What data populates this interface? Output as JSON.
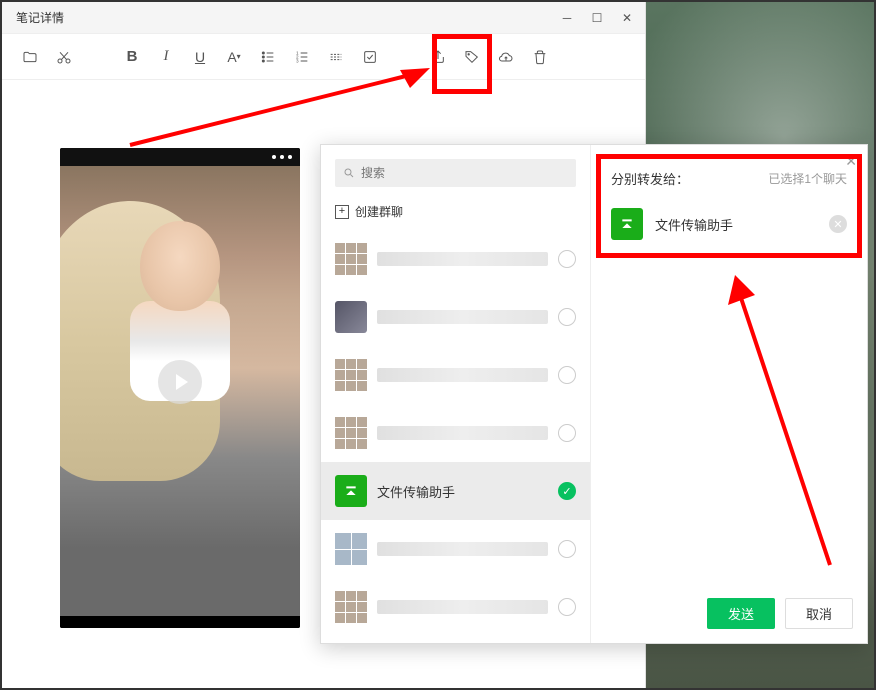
{
  "window": {
    "title": "笔记详情"
  },
  "toolbar": {
    "folder": "folder",
    "cut": "cut",
    "bold": "B",
    "italic": "I",
    "underline": "U",
    "font_color": "A",
    "bullet_list": "list",
    "ordered_list": "olist",
    "divider": "divider",
    "checklist": "checklist",
    "share": "share",
    "tag": "tag",
    "cloud": "cloud",
    "delete": "delete"
  },
  "forward_panel": {
    "search_placeholder": "搜索",
    "create_group_label": "创建群聊",
    "title": "分别转发给：",
    "selected_count_label": "已选择1个聊天",
    "send_label": "发送",
    "cancel_label": "取消",
    "file_helper_label": "文件传输助手",
    "contacts": [
      {
        "type": "grid",
        "selected": false
      },
      {
        "type": "single",
        "selected": false
      },
      {
        "type": "grid",
        "selected": false
      },
      {
        "type": "grid",
        "selected": false
      },
      {
        "type": "file_helper",
        "label": "文件传输助手",
        "selected": true
      },
      {
        "type": "grid2",
        "selected": false
      },
      {
        "type": "grid",
        "selected": false
      }
    ]
  }
}
